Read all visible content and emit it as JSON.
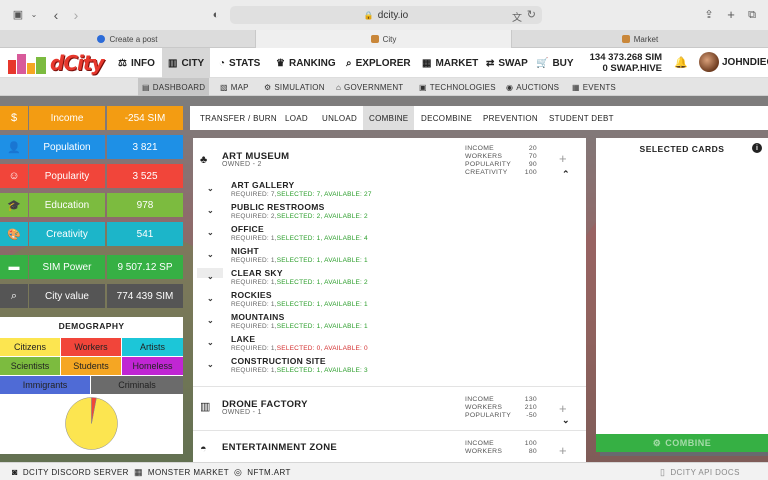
{
  "browser": {
    "url": "dcity.io",
    "tabs": [
      "Create a post",
      "City",
      "Market"
    ]
  },
  "header": {
    "logo_text": "dCity",
    "nav": [
      {
        "label": "INFO",
        "icon": "scale-icon"
      },
      {
        "label": "CITY",
        "icon": "city-icon"
      },
      {
        "label": "STATS",
        "icon": "pie-chart-icon"
      },
      {
        "label": "RANKING",
        "icon": "trophy-icon"
      },
      {
        "label": "EXPLORER",
        "icon": "search-icon"
      },
      {
        "label": "MARKET",
        "icon": "store-icon"
      },
      {
        "label": "SWAP",
        "icon": "swap-icon"
      },
      {
        "label": "BUY",
        "icon": "cart-icon"
      }
    ],
    "balance_sim": "134 373.268 SIM",
    "balance_swap": "0 SWAP.HIVE",
    "username": "JOHNDIEG"
  },
  "subnav": [
    {
      "label": "DASHBOARD"
    },
    {
      "label": "MAP"
    },
    {
      "label": "SIMULATION"
    },
    {
      "label": "GOVERNMENT"
    },
    {
      "label": "TECHNOLOGIES"
    },
    {
      "label": "AUCTIONS"
    },
    {
      "label": "EVENTS"
    }
  ],
  "stats": [
    {
      "label": "Income",
      "value": "-254 SIM",
      "color": "#f39c12",
      "icon": "dollar-icon"
    },
    {
      "label": "Population",
      "value": "3 821",
      "color": "#1e90e6",
      "icon": "user-icon"
    },
    {
      "label": "Popularity",
      "value": "3 525",
      "color": "#f1453a",
      "icon": "smile-icon"
    },
    {
      "label": "Education",
      "value": "978",
      "color": "#7cbb3f",
      "icon": "graduation-icon"
    },
    {
      "label": "Creativity",
      "value": "541",
      "color": "#1cb5c9",
      "icon": "palette-icon"
    },
    {
      "label": "SIM Power",
      "value": "9 507.12 SP",
      "color": "#36b044",
      "icon": "money-icon"
    },
    {
      "label": "City value",
      "value": "774 439 SIM",
      "color": "#555555",
      "icon": "magnify-icon"
    }
  ],
  "demography": {
    "title": "DEMOGRAPHY",
    "legend": [
      {
        "label": "Citizens",
        "color": "#fce550"
      },
      {
        "label": "Workers",
        "color": "#f1453a"
      },
      {
        "label": "Artists",
        "color": "#1cc6d8"
      },
      {
        "label": "Scientists",
        "color": "#7cbb3f"
      },
      {
        "label": "Students",
        "color": "#f5a623"
      },
      {
        "label": "Homeless",
        "color": "#c026d3"
      },
      {
        "label": "Immigrants",
        "color": "#4f6bd6"
      },
      {
        "label": "Criminals",
        "color": "#6b6b6b"
      }
    ],
    "pie_fractions": [
      0.97,
      0.03
    ]
  },
  "main_tabs": [
    "TRANSFER / BURN",
    "LOAD",
    "UNLOAD",
    "COMBINE",
    "DECOMBINE",
    "PREVENTION",
    "STUDENT DEBT"
  ],
  "cards": [
    {
      "name": "ART MUSEUM",
      "owned": "OWNED - 2",
      "icon": "art-icon",
      "stats": [
        {
          "k": "INCOME",
          "v": "20"
        },
        {
          "k": "WORKERS",
          "v": "70"
        },
        {
          "k": "POPULARITY",
          "v": "90"
        },
        {
          "k": "CREATIVITY",
          "v": "100"
        }
      ]
    },
    {
      "name": "DRONE FACTORY",
      "owned": "OWNED - 1",
      "icon": "factory-icon",
      "stats": [
        {
          "k": "INCOME",
          "v": "130"
        },
        {
          "k": "WORKERS",
          "v": "210"
        },
        {
          "k": "POPULARITY",
          "v": "-50"
        }
      ]
    },
    {
      "name": "ENTERTAINMENT ZONE",
      "owned": "",
      "icon": "zone-icon",
      "stats": [
        {
          "k": "INCOME",
          "v": "100"
        },
        {
          "k": "WORKERS",
          "v": "80"
        }
      ]
    }
  ],
  "requirements": [
    {
      "name": "ART GALLERY",
      "required": "REQUIRED: 7,",
      "selected": "SELECTED: 7,",
      "available": "AVAILABLE: 27",
      "ok": true
    },
    {
      "name": "PUBLIC RESTROOMS",
      "required": "REQUIRED: 2,",
      "selected": "SELECTED: 2,",
      "available": "AVAILABLE: 2",
      "ok": true
    },
    {
      "name": "OFFICE",
      "required": "REQUIRED: 1,",
      "selected": "SELECTED: 1,",
      "available": "AVAILABLE: 4",
      "ok": true
    },
    {
      "name": "NIGHT",
      "required": "REQUIRED: 1,",
      "selected": "SELECTED: 1,",
      "available": "AVAILABLE: 1",
      "ok": true
    },
    {
      "name": "CLEAR SKY",
      "required": "REQUIRED: 1,",
      "selected": "SELECTED: 1,",
      "available": "AVAILABLE: 2",
      "ok": true
    },
    {
      "name": "ROCKIES",
      "required": "REQUIRED: 1,",
      "selected": "SELECTED: 1,",
      "available": "AVAILABLE: 1",
      "ok": true
    },
    {
      "name": "MOUNTAINS",
      "required": "REQUIRED: 1,",
      "selected": "SELECTED: 1,",
      "available": "AVAILABLE: 1",
      "ok": true
    },
    {
      "name": "LAKE",
      "required": "REQUIRED: 1,",
      "selected": "SELECTED: 0,",
      "available": "AVAILABLE: 0",
      "ok": false
    },
    {
      "name": "CONSTRUCTION SITE",
      "required": "REQUIRED: 1,",
      "selected": "SELECTED: 1,",
      "available": "AVAILABLE: 3",
      "ok": true
    }
  ],
  "selected_panel": {
    "title": "SELECTED CARDS",
    "combine_label": "COMBINE"
  },
  "footer": {
    "discord": "DCITY DISCORD SERVER",
    "monster": "MONSTER MARKET",
    "nftm": "NFTM.ART",
    "docs": "DCITY API DOCS"
  }
}
